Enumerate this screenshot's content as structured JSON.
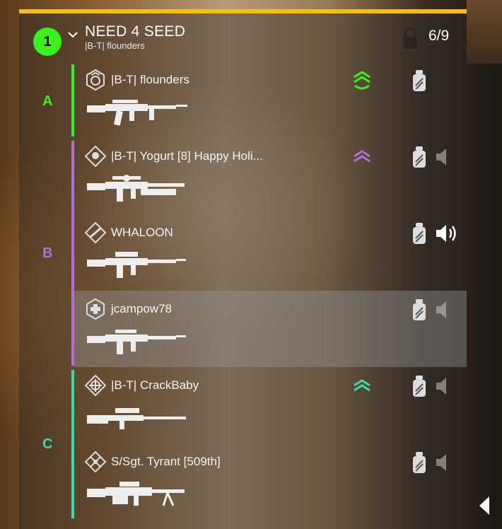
{
  "squad": {
    "number": "1",
    "name": "NEED 4 SEED",
    "leader": "|B-T| flounders",
    "count": "6/9",
    "locked": true
  },
  "colors": {
    "top_bar": "#f5bf10",
    "squad_badge": "#3cf01e",
    "team_a": "#3cf01e",
    "team_b": "#b56fd0",
    "team_c": "#3fd9a8"
  },
  "fireteams": [
    {
      "letter": "A"
    },
    {
      "letter": "B"
    },
    {
      "letter": "C"
    }
  ],
  "members": [
    {
      "name": "|B-T| flounders",
      "rank_icon": "leader-rank-icon",
      "weapon": "assault-rifle-foregrip-icon",
      "rank_chevrons": "triple-chevron-green-icon",
      "speaker": "none"
    },
    {
      "name": "|B-T| Yogurt [8] Happy Holi...",
      "rank_icon": "diamond-role-icon",
      "weapon": "rifle-grenade-launcher-icon",
      "rank_chevrons": "double-chevron-purple-icon",
      "speaker": "speaker-muted-icon"
    },
    {
      "name": "WHALOON",
      "rank_icon": "diamond-rifle-icon",
      "weapon": "assault-rifle-scoped-icon",
      "rank_chevrons": "",
      "speaker": "speaker-active-icon"
    },
    {
      "name": "jcampow78",
      "rank_icon": "medic-shield-icon",
      "weapon": "assault-rifle-icon",
      "rank_chevrons": "",
      "speaker": "speaker-muted-icon"
    },
    {
      "name": "|B-T| CrackBaby",
      "rank_icon": "crosshair-diamond-icon",
      "weapon": "sniper-rifle-icon",
      "rank_chevrons": "double-chevron-teal-icon",
      "speaker": "speaker-muted-icon"
    },
    {
      "name": "S/Sgt. Tyrant [509th]",
      "rank_icon": "diamond-cross-icon",
      "weapon": "machine-gun-icon",
      "rank_chevrons": "",
      "speaker": "speaker-muted-icon"
    }
  ]
}
